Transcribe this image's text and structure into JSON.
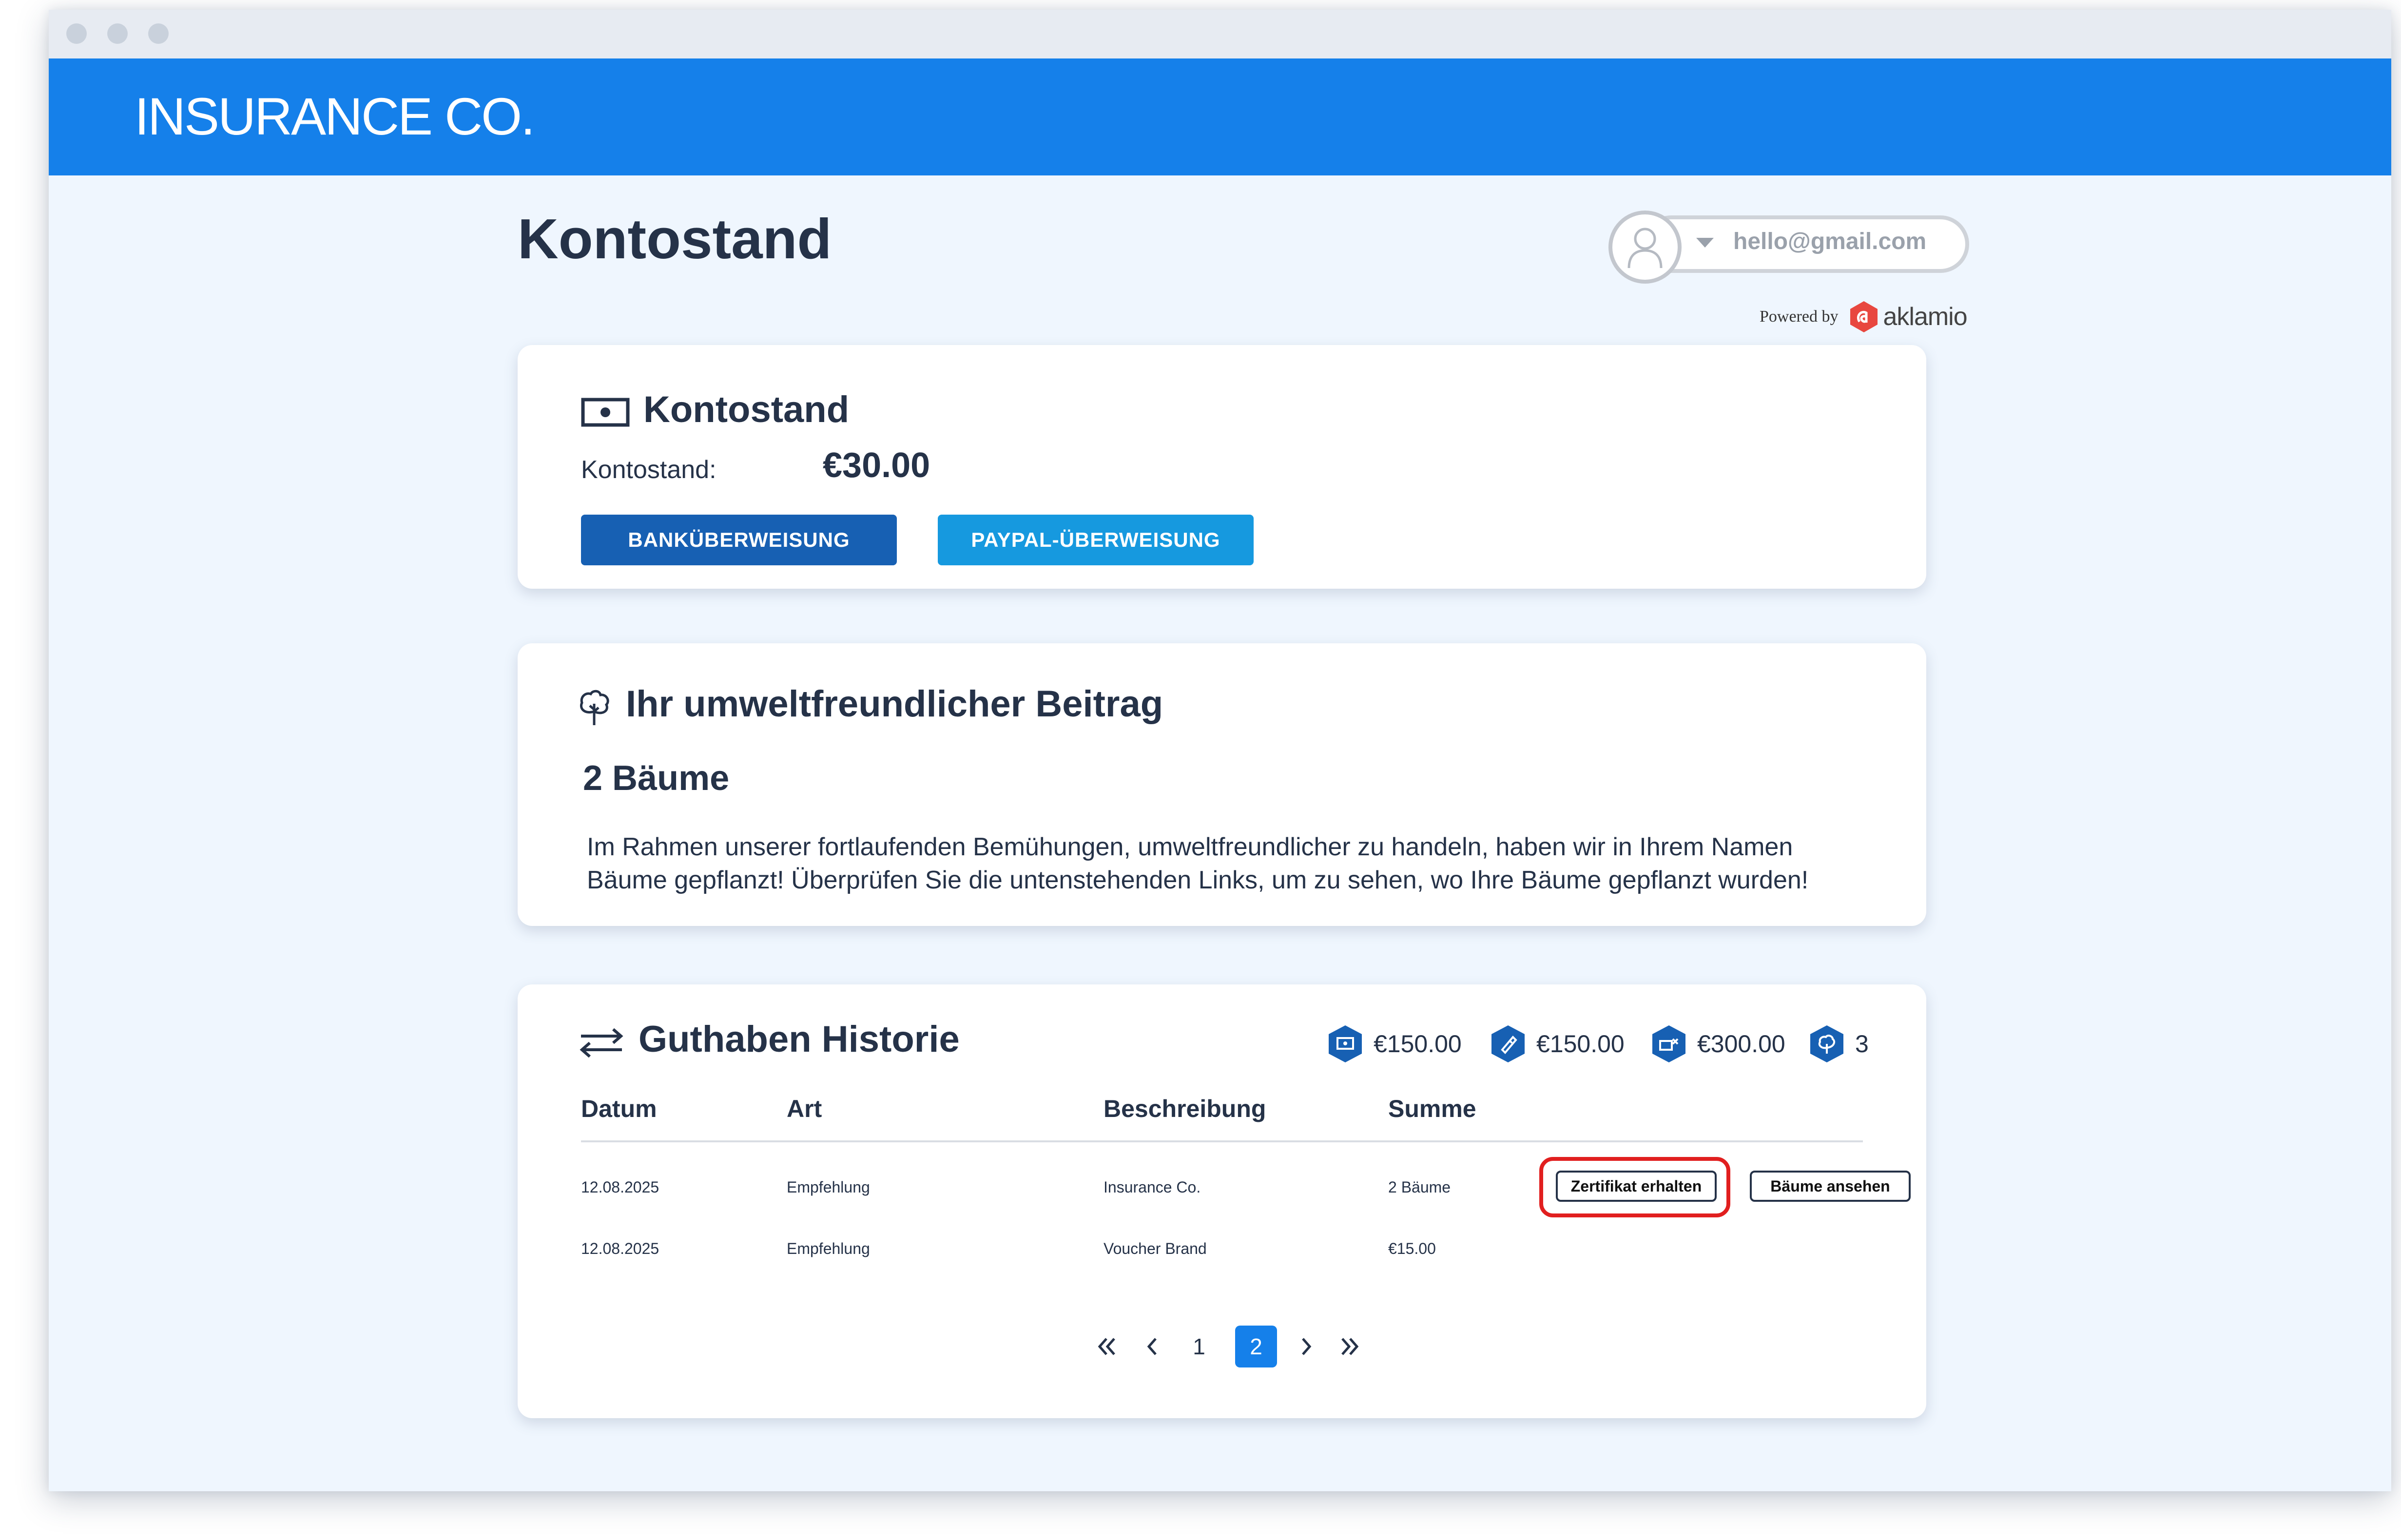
{
  "brand": {
    "name": "INSURANCE CO."
  },
  "page": {
    "title": "Kontostand"
  },
  "user": {
    "email": "hello@gmail.com",
    "powered_by": "Powered by",
    "partner": "aklamio"
  },
  "balance_card": {
    "title": "Kontostand",
    "label": "Kontostand:",
    "value": "€30.00",
    "bank_button": "BANKÜBERWEISUNG",
    "paypal_button": "PAYPAL-ÜBERWEISUNG"
  },
  "eco_card": {
    "title": "Ihr umweltfreundlicher Beitrag",
    "trees": "2 Bäume",
    "text": "Im Rahmen unserer fortlaufenden Bemühungen, umweltfreundlicher zu handeln, haben wir in Ihrem Namen Bäume gepflanzt! Überprüfen Sie die untenstehenden Links, um zu sehen, wo Ihre Bäume gepflanzt wurden!"
  },
  "history": {
    "title": "Guthaben Historie",
    "stats": [
      {
        "icon": "money-icon",
        "value": "€150.00"
      },
      {
        "icon": "voucher-icon",
        "value": "€150.00"
      },
      {
        "icon": "transfer-icon",
        "value": "€300.00"
      },
      {
        "icon": "tree-icon",
        "value": "3"
      }
    ],
    "columns": [
      "Datum",
      "Art",
      "Beschreibung",
      "Summe"
    ],
    "rows": [
      {
        "date": "12.08.2025",
        "type": "Empfehlung",
        "description": "Insurance Co.",
        "sum": "2 Bäume"
      },
      {
        "date": "12.08.2025",
        "type": "Empfehlung",
        "description": "Voucher Brand",
        "sum": "€15.00"
      }
    ],
    "certificate_button": "Zertifikat erhalten",
    "view_trees_button": "Bäume ansehen",
    "pagination": {
      "pages": [
        "1",
        "2"
      ],
      "current": "2"
    }
  },
  "colors": {
    "header_blue": "#1580ea",
    "bank_button": "#1760b3",
    "paypal_button": "#1699df",
    "background": "#eff6fe",
    "text_dark": "#253248",
    "highlight_red": "#e11f1f",
    "aklamio_red": "#e8473f"
  }
}
